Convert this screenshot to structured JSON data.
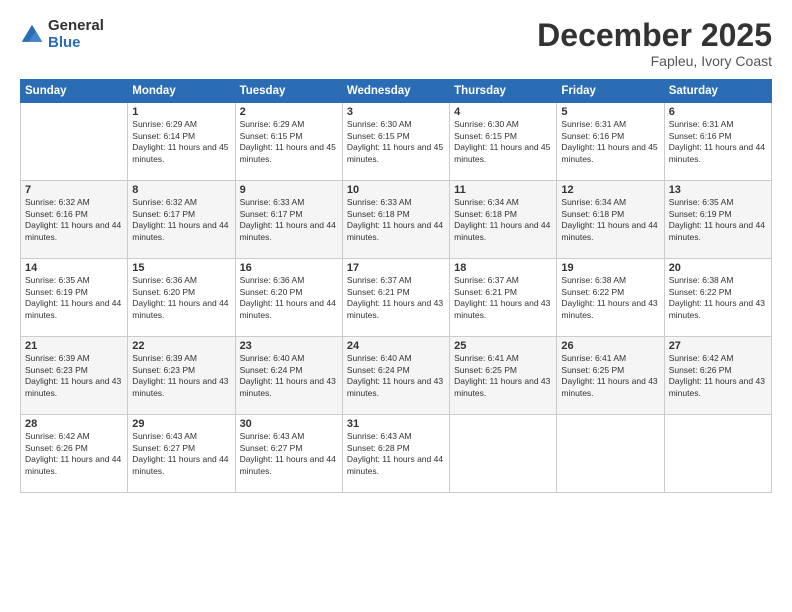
{
  "logo": {
    "general": "General",
    "blue": "Blue"
  },
  "header": {
    "month": "December 2025",
    "location": "Fapleu, Ivory Coast"
  },
  "days_header": [
    "Sunday",
    "Monday",
    "Tuesday",
    "Wednesday",
    "Thursday",
    "Friday",
    "Saturday"
  ],
  "weeks": [
    [
      {
        "day": "",
        "sunrise": "",
        "sunset": "",
        "daylight": ""
      },
      {
        "day": "1",
        "sunrise": "Sunrise: 6:29 AM",
        "sunset": "Sunset: 6:14 PM",
        "daylight": "Daylight: 11 hours and 45 minutes."
      },
      {
        "day": "2",
        "sunrise": "Sunrise: 6:29 AM",
        "sunset": "Sunset: 6:15 PM",
        "daylight": "Daylight: 11 hours and 45 minutes."
      },
      {
        "day": "3",
        "sunrise": "Sunrise: 6:30 AM",
        "sunset": "Sunset: 6:15 PM",
        "daylight": "Daylight: 11 hours and 45 minutes."
      },
      {
        "day": "4",
        "sunrise": "Sunrise: 6:30 AM",
        "sunset": "Sunset: 6:15 PM",
        "daylight": "Daylight: 11 hours and 45 minutes."
      },
      {
        "day": "5",
        "sunrise": "Sunrise: 6:31 AM",
        "sunset": "Sunset: 6:16 PM",
        "daylight": "Daylight: 11 hours and 45 minutes."
      },
      {
        "day": "6",
        "sunrise": "Sunrise: 6:31 AM",
        "sunset": "Sunset: 6:16 PM",
        "daylight": "Daylight: 11 hours and 44 minutes."
      }
    ],
    [
      {
        "day": "7",
        "sunrise": "Sunrise: 6:32 AM",
        "sunset": "Sunset: 6:16 PM",
        "daylight": "Daylight: 11 hours and 44 minutes."
      },
      {
        "day": "8",
        "sunrise": "Sunrise: 6:32 AM",
        "sunset": "Sunset: 6:17 PM",
        "daylight": "Daylight: 11 hours and 44 minutes."
      },
      {
        "day": "9",
        "sunrise": "Sunrise: 6:33 AM",
        "sunset": "Sunset: 6:17 PM",
        "daylight": "Daylight: 11 hours and 44 minutes."
      },
      {
        "day": "10",
        "sunrise": "Sunrise: 6:33 AM",
        "sunset": "Sunset: 6:18 PM",
        "daylight": "Daylight: 11 hours and 44 minutes."
      },
      {
        "day": "11",
        "sunrise": "Sunrise: 6:34 AM",
        "sunset": "Sunset: 6:18 PM",
        "daylight": "Daylight: 11 hours and 44 minutes."
      },
      {
        "day": "12",
        "sunrise": "Sunrise: 6:34 AM",
        "sunset": "Sunset: 6:18 PM",
        "daylight": "Daylight: 11 hours and 44 minutes."
      },
      {
        "day": "13",
        "sunrise": "Sunrise: 6:35 AM",
        "sunset": "Sunset: 6:19 PM",
        "daylight": "Daylight: 11 hours and 44 minutes."
      }
    ],
    [
      {
        "day": "14",
        "sunrise": "Sunrise: 6:35 AM",
        "sunset": "Sunset: 6:19 PM",
        "daylight": "Daylight: 11 hours and 44 minutes."
      },
      {
        "day": "15",
        "sunrise": "Sunrise: 6:36 AM",
        "sunset": "Sunset: 6:20 PM",
        "daylight": "Daylight: 11 hours and 44 minutes."
      },
      {
        "day": "16",
        "sunrise": "Sunrise: 6:36 AM",
        "sunset": "Sunset: 6:20 PM",
        "daylight": "Daylight: 11 hours and 44 minutes."
      },
      {
        "day": "17",
        "sunrise": "Sunrise: 6:37 AM",
        "sunset": "Sunset: 6:21 PM",
        "daylight": "Daylight: 11 hours and 43 minutes."
      },
      {
        "day": "18",
        "sunrise": "Sunrise: 6:37 AM",
        "sunset": "Sunset: 6:21 PM",
        "daylight": "Daylight: 11 hours and 43 minutes."
      },
      {
        "day": "19",
        "sunrise": "Sunrise: 6:38 AM",
        "sunset": "Sunset: 6:22 PM",
        "daylight": "Daylight: 11 hours and 43 minutes."
      },
      {
        "day": "20",
        "sunrise": "Sunrise: 6:38 AM",
        "sunset": "Sunset: 6:22 PM",
        "daylight": "Daylight: 11 hours and 43 minutes."
      }
    ],
    [
      {
        "day": "21",
        "sunrise": "Sunrise: 6:39 AM",
        "sunset": "Sunset: 6:23 PM",
        "daylight": "Daylight: 11 hours and 43 minutes."
      },
      {
        "day": "22",
        "sunrise": "Sunrise: 6:39 AM",
        "sunset": "Sunset: 6:23 PM",
        "daylight": "Daylight: 11 hours and 43 minutes."
      },
      {
        "day": "23",
        "sunrise": "Sunrise: 6:40 AM",
        "sunset": "Sunset: 6:24 PM",
        "daylight": "Daylight: 11 hours and 43 minutes."
      },
      {
        "day": "24",
        "sunrise": "Sunrise: 6:40 AM",
        "sunset": "Sunset: 6:24 PM",
        "daylight": "Daylight: 11 hours and 43 minutes."
      },
      {
        "day": "25",
        "sunrise": "Sunrise: 6:41 AM",
        "sunset": "Sunset: 6:25 PM",
        "daylight": "Daylight: 11 hours and 43 minutes."
      },
      {
        "day": "26",
        "sunrise": "Sunrise: 6:41 AM",
        "sunset": "Sunset: 6:25 PM",
        "daylight": "Daylight: 11 hours and 43 minutes."
      },
      {
        "day": "27",
        "sunrise": "Sunrise: 6:42 AM",
        "sunset": "Sunset: 6:26 PM",
        "daylight": "Daylight: 11 hours and 43 minutes."
      }
    ],
    [
      {
        "day": "28",
        "sunrise": "Sunrise: 6:42 AM",
        "sunset": "Sunset: 6:26 PM",
        "daylight": "Daylight: 11 hours and 44 minutes."
      },
      {
        "day": "29",
        "sunrise": "Sunrise: 6:43 AM",
        "sunset": "Sunset: 6:27 PM",
        "daylight": "Daylight: 11 hours and 44 minutes."
      },
      {
        "day": "30",
        "sunrise": "Sunrise: 6:43 AM",
        "sunset": "Sunset: 6:27 PM",
        "daylight": "Daylight: 11 hours and 44 minutes."
      },
      {
        "day": "31",
        "sunrise": "Sunrise: 6:43 AM",
        "sunset": "Sunset: 6:28 PM",
        "daylight": "Daylight: 11 hours and 44 minutes."
      },
      {
        "day": "",
        "sunrise": "",
        "sunset": "",
        "daylight": ""
      },
      {
        "day": "",
        "sunrise": "",
        "sunset": "",
        "daylight": ""
      },
      {
        "day": "",
        "sunrise": "",
        "sunset": "",
        "daylight": ""
      }
    ]
  ]
}
